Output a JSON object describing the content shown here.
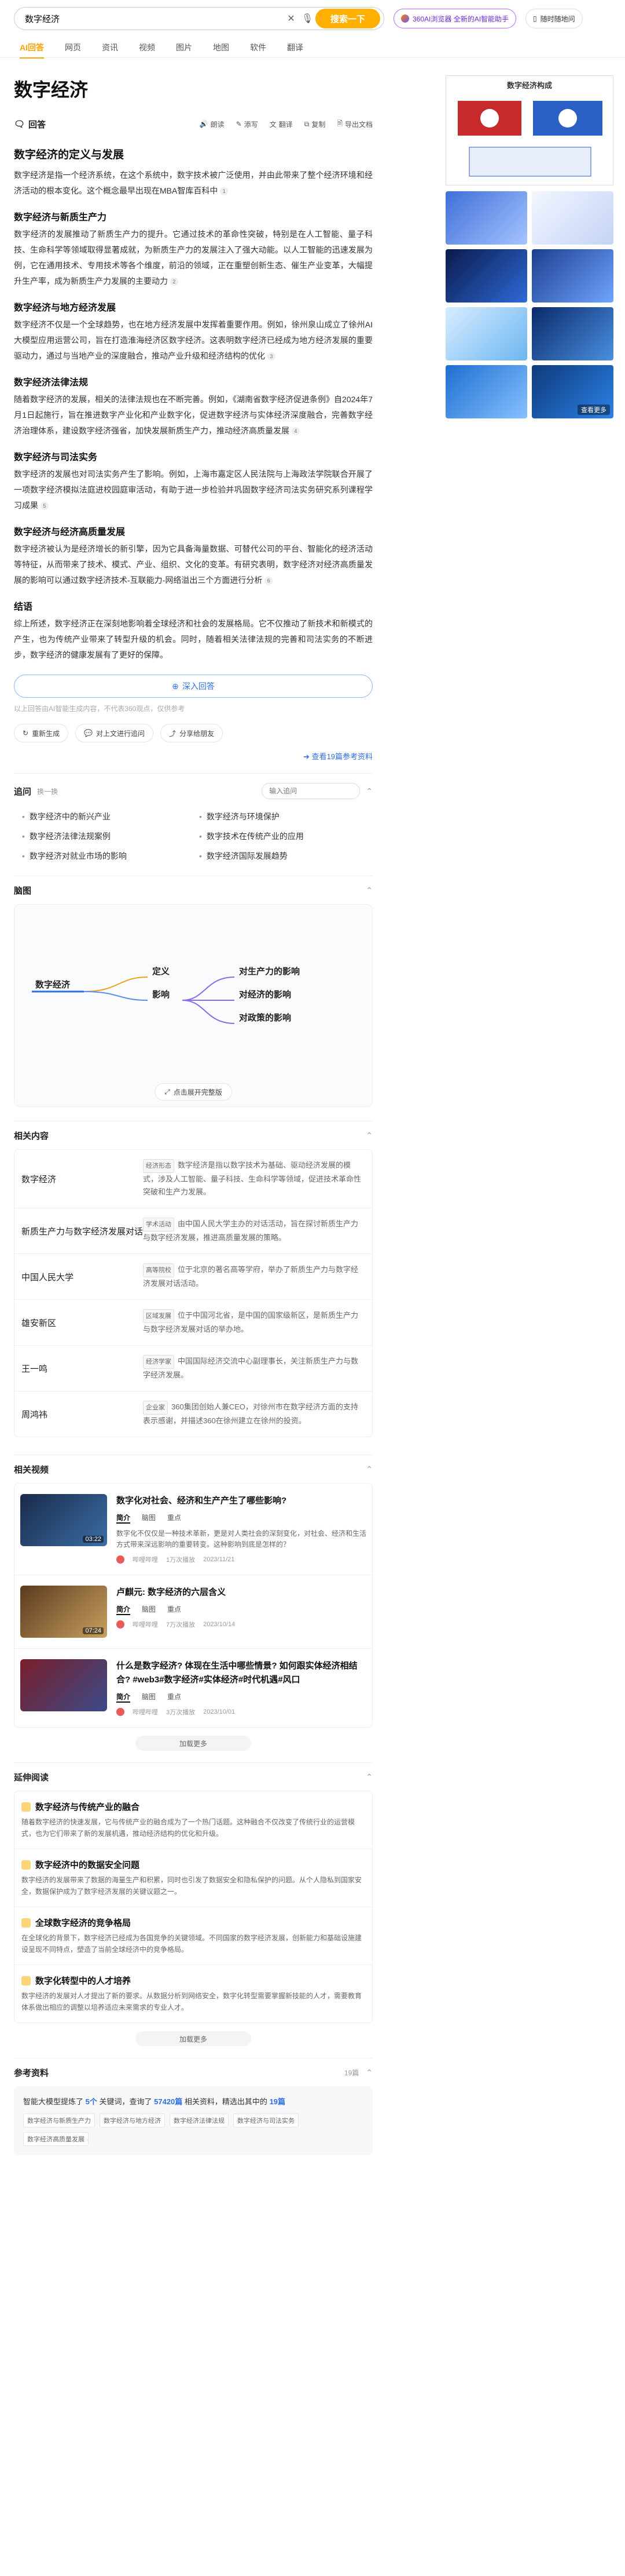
{
  "search": {
    "value": "数字经济",
    "button": "搜索一下"
  },
  "promo": {
    "label": "360AI浏览器 全新的AI智能助手"
  },
  "topright": {
    "label": "随时随地问"
  },
  "tabs": [
    "AI回答",
    "网页",
    "资讯",
    "视频",
    "图片",
    "地图",
    "软件",
    "翻译"
  ],
  "answer": {
    "title": "数字经济",
    "label": "回答",
    "actions": [
      "朗读",
      "添写",
      "翻译",
      "复制",
      "导出文档"
    ],
    "sections": [
      {
        "h": "数字经济的定义与发展",
        "p": "数字经济是指一个经济系统，在这个系统中，数字技术被广泛使用，并由此带来了整个经济环境和经济活动的根本变化。这个概念最早出现在MBA智库百科中",
        "r": "1"
      },
      {
        "h": "数字经济与新质生产力",
        "p": "数字经济的发展推动了新质生产力的提升。它通过技术的革命性突破，特别是在人工智能、量子科技、生命科学等领域取得显著成就，为新质生产力的发展注入了强大动能。以人工智能的迅速发展为例，它在通用技术、专用技术等各个维度，前沿的领域，正在重塑创新生态、催生产业变革，大幅提升生产率，成为新质生产力发展的主要动力",
        "r": "2"
      },
      {
        "h": "数字经济与地方经济发展",
        "p": "数字经济不仅是一个全球趋势，也在地方经济发展中发挥着重要作用。例如，徐州泉山成立了徐州AI大模型应用运营公司，旨在打造淮海经济区数字经济。这表明数字经济已经成为地方经济发展的重要驱动力，通过与当地产业的深度融合，推动产业升级和经济结构的优化",
        "r": "3"
      },
      {
        "h": "数字经济法律法规",
        "p": "随着数字经济的发展，相关的法律法规也在不断完善。例如，《湖南省数字经济促进条例》自2024年7月1日起施行，旨在推进数字产业化和产业数字化，促进数字经济与实体经济深度融合，完善数字经济治理体系，建设数字经济强省，加快发展新质生产力，推动经济高质量发展",
        "r": "4"
      },
      {
        "h": "数字经济与司法实务",
        "p": "数字经济的发展也对司法实务产生了影响。例如，上海市嘉定区人民法院与上海政法学院联合开展了一项数字经济模拟法庭进校园庭审活动，有助于进一步检验并巩固数字经济司法实务研究系列课程学习成果",
        "r": "5"
      },
      {
        "h": "数字经济与经济高质量发展",
        "p": "数字经济被认为是经济增长的新引擎，因为它具备海量数据、可替代公司的平台、智能化的经济活动等特征，从而带来了技术、模式、产业、组织、文化的变革。有研究表明，数字经济对经济高质量发展的影响可以通过数字经济技术-互联能力-网络溢出三个方面进行分析",
        "r": "6"
      },
      {
        "h": "结语",
        "p": "综上所述，数字经济正在深刻地影响着全球经济和社会的发展格局。它不仅推动了新技术和新模式的产生，也为传统产业带来了转型升级的机会。同时，随着相关法律法规的完善和司法实务的不断进步，数字经济的健康发展有了更好的保障。",
        "r": ""
      }
    ],
    "deep_button": "深入回答",
    "disclaimer": "以上回答由AI智能生成内容，不代表360观点，仅供参考",
    "tools": [
      "重新生成",
      "对上文进行追问",
      "分享给朋友"
    ],
    "more_link": "查看19篇参考资料"
  },
  "qa": {
    "label": "追问",
    "sub": "换一换",
    "input_placeholder": "输入追问",
    "items": [
      "数字经济中的新兴产业",
      "数字经济与环境保护",
      "数字经济法律法规案例",
      "数字技术在传统产业的应用",
      "数字经济对就业市场的影响",
      "数字经济国际发展趋势"
    ]
  },
  "mindmap": {
    "label": "脑图",
    "root": "数字经济",
    "branches": [
      "定义",
      "影响"
    ],
    "leaves": [
      "对生产力的影响",
      "对经济的影响",
      "对政策的影响"
    ],
    "expand": "点击展开完整版"
  },
  "related": {
    "label": "相关内容",
    "rows": [
      {
        "name": "数字经济",
        "tag": "经济形态",
        "desc": "数字经济是指以数字技术为基础、驱动经济发展的模式，涉及人工智能、量子科技、生命科学等领域，促进技术革命性突破和生产力发展。"
      },
      {
        "name": "新质生产力与数字经济发展对话",
        "tag": "学术活动",
        "desc": "由中国人民大学主办的对话活动，旨在探讨新质生产力与数字经济发展，推进高质量发展的策略。"
      },
      {
        "name": "中国人民大学",
        "tag": "高等院校",
        "desc": "位于北京的著名高等学府，举办了新质生产力与数字经济发展对话活动。"
      },
      {
        "name": "雄安新区",
        "tag": "区域发展",
        "desc": "位于中国河北省，是中国的国家级新区，是新质生产力与数字经济发展对话的举办地。"
      },
      {
        "name": "王一鸣",
        "tag": "经济学家",
        "desc": "中国国际经济交流中心副理事长，关注新质生产力与数字经济发展。"
      },
      {
        "name": "周鸿祎",
        "tag": "企业家",
        "desc": "360集团创始人兼CEO，对徐州市在数字经济方面的支持表示感谢，并描述360在徐州建立在徐州的投资。"
      }
    ]
  },
  "videos": {
    "label": "相关视频",
    "tabs": [
      "简介",
      "脑图",
      "重点"
    ],
    "items": [
      {
        "title": "数字化对社会、经济和生产产生了哪些影响?",
        "desc": "数字化不仅仅是一种技术革新，更是对人类社会的深刻变化，对社会、经济和生活方式带来深远影响的重要转变。这种影响到底是怎样的？",
        "author": "哔哩哔哩",
        "views": "1万次播放",
        "date": "2023/11/21",
        "dur": "03:22"
      },
      {
        "title": "卢麒元: 数字经济的六层含义",
        "desc": "",
        "author": "哔哩哔哩",
        "views": "7万次播放",
        "date": "2023/10/14",
        "dur": "07:24"
      },
      {
        "title": "什么是数字经济? 体现在生活中哪些情景? 如何跟实体经济相结合? #web3#数字经济#实体经济#时代机遇#风口",
        "desc": "",
        "author": "哔哩哔哩",
        "views": "3万次播放",
        "date": "2023/10/01",
        "dur": ""
      }
    ],
    "load_more": "加载更多"
  },
  "extended": {
    "label": "延伸阅读",
    "items": [
      {
        "title": "数字经济与传统产业的融合",
        "desc": "随着数字经济的快速发展，它与传统产业的融合成为了一个热门话题。这种融合不仅改变了传统行业的运营模式，也为它们带来了新的发展机遇，推动经济结构的优化和升级。"
      },
      {
        "title": "数字经济中的数据安全问题",
        "desc": "数字经济的发展带来了数据的海量生产和积累，同时也引发了数据安全和隐私保护的问题。从个人隐私到国家安全，数据保护成为了数字经济发展的关键议题之一。"
      },
      {
        "title": "全球数字经济的竞争格局",
        "desc": "在全球化的背景下，数字经济已经成为各国竞争的关键领域。不同国家的数字经济发展，创新能力和基础设施建设呈现不同特点，塑造了当前全球经济中的竞争格局。"
      },
      {
        "title": "数字化转型中的人才培养",
        "desc": "数字经济的发展对人才提出了新的要求。从数据分析到网络安全，数字化转型需要掌握新技能的人才，需要教育体系做出相应的调整以培养适应未来需求的专业人才。"
      }
    ],
    "load_more": "加载更多"
  },
  "refs": {
    "label": "参考资料",
    "count": "19篇",
    "summary_pre": "智能大模型提炼了",
    "summary_kw": "5个",
    "summary_mid": "关键词，查询了",
    "summary_n": "57420篇",
    "summary_mid2": "相关资料，精选出其中的",
    "summary_m": "19篇",
    "chips": [
      "数字经济与新质生产力",
      "数字经济与地方经济",
      "数字经济法律法规",
      "数字经济与司法实务",
      "数字经济高质量发展"
    ]
  },
  "side": {
    "head": "数字经济构成",
    "more": "查看更多"
  },
  "colors": {
    "accent": "#ffa000",
    "link": "#2f6fe0"
  }
}
